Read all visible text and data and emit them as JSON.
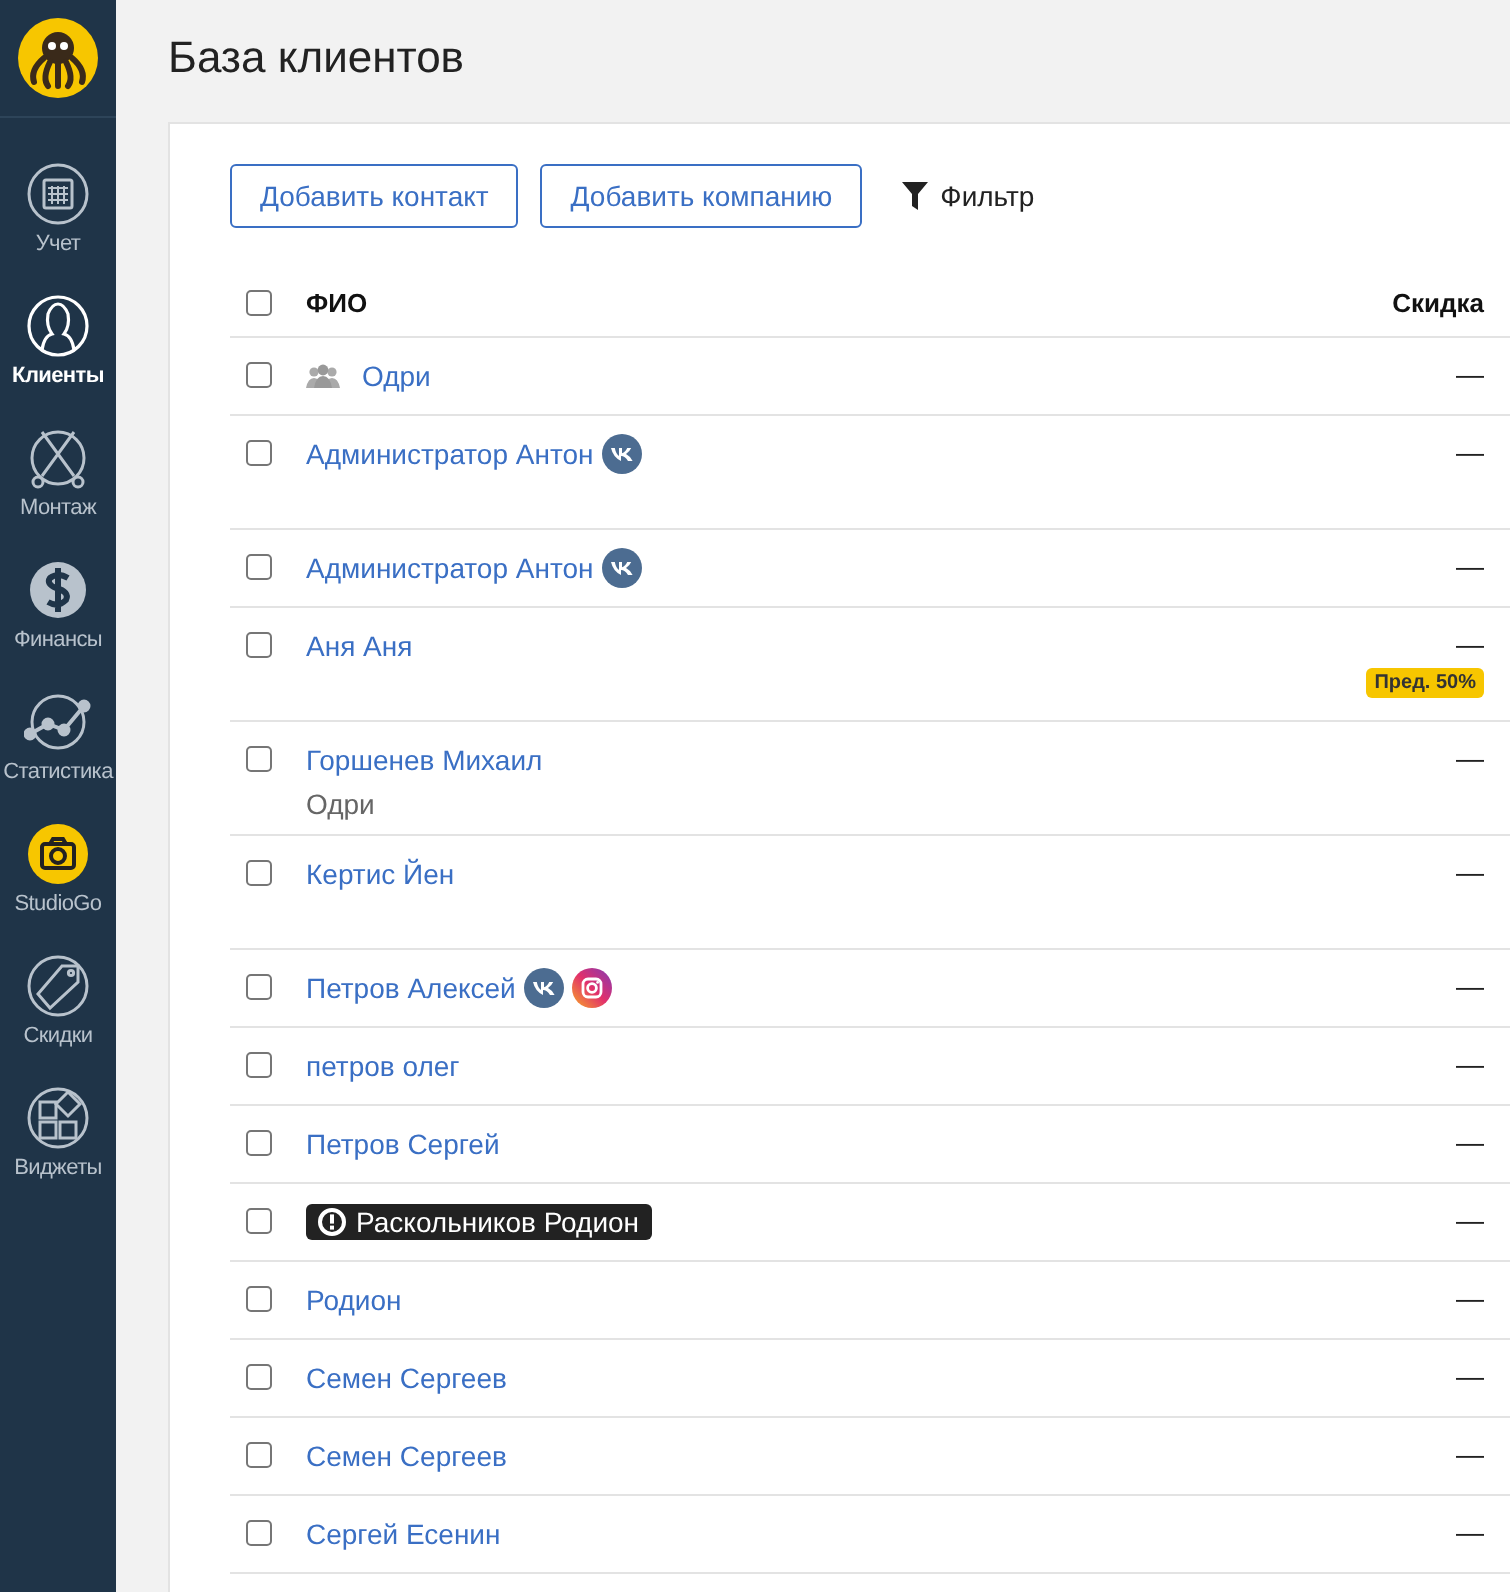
{
  "sidebar": {
    "items": [
      {
        "label": "Учет",
        "selected": false
      },
      {
        "label": "Клиенты",
        "selected": true
      },
      {
        "label": "Монтаж",
        "selected": false
      },
      {
        "label": "Финансы",
        "selected": false
      },
      {
        "label": "Статистика",
        "selected": false
      },
      {
        "label": "StudioGo",
        "selected": false
      },
      {
        "label": "Скидки",
        "selected": false
      },
      {
        "label": "Виджеты",
        "selected": false
      }
    ]
  },
  "title": "База клиентов",
  "toolbar": {
    "buttons": [
      "Добавить контакт",
      "Добавить компанию"
    ],
    "filter": "Фильтр"
  },
  "table": {
    "select_all_checked": false,
    "columns": [
      "ФИО",
      "Скидка"
    ],
    "rows": [
      {
        "name": "Одри",
        "kind": "group",
        "tall": false,
        "socials": [],
        "discount": "—",
        "checked": false
      },
      {
        "name": "Администратор Антон",
        "kind": "contact",
        "tall": true,
        "socials": [
          {
            "kind": "vk"
          }
        ],
        "discount": "—",
        "checked": false
      },
      {
        "name": "Администратор Антон",
        "kind": "contact",
        "tall": false,
        "socials": [
          {
            "kind": "vk"
          }
        ],
        "discount": "—",
        "checked": false
      },
      {
        "name": "Аня Аня",
        "kind": "contact",
        "tall": true,
        "socials": [],
        "discount": "—",
        "badge": "Пред. 50%",
        "checked": false
      },
      {
        "name": "Горшенев Михаил",
        "kind": "contact",
        "tall": true,
        "socials": [],
        "subtitle": "Одри",
        "discount": "—",
        "checked": false
      },
      {
        "name": "Кертис Йен",
        "kind": "contact",
        "tall": true,
        "socials": [],
        "discount": "—",
        "checked": false
      },
      {
        "name": "Петров Алексей",
        "kind": "contact",
        "tall": false,
        "socials": [
          {
            "kind": "vk"
          },
          {
            "kind": "instagram"
          }
        ],
        "discount": "—",
        "checked": false
      },
      {
        "name": "петров олег",
        "kind": "contact",
        "tall": false,
        "socials": [],
        "discount": "—",
        "checked": false
      },
      {
        "name": "Петров Сергей",
        "kind": "contact",
        "tall": false,
        "socials": [],
        "discount": "—",
        "checked": false
      },
      {
        "name": "Раскольников Родион",
        "kind": "blocked",
        "tall": false,
        "socials": [],
        "discount": "—",
        "checked": false
      },
      {
        "name": "Родион",
        "kind": "contact",
        "tall": false,
        "socials": [],
        "discount": "—",
        "checked": false
      },
      {
        "name": "Семен Сергеев",
        "kind": "contact",
        "tall": false,
        "socials": [],
        "discount": "—",
        "checked": false
      },
      {
        "name": "Семен Сергеев",
        "kind": "contact",
        "tall": false,
        "socials": [],
        "discount": "—",
        "checked": false
      },
      {
        "name": "Сергей Есенин",
        "kind": "contact",
        "tall": false,
        "socials": [],
        "discount": "—",
        "checked": false
      }
    ]
  }
}
